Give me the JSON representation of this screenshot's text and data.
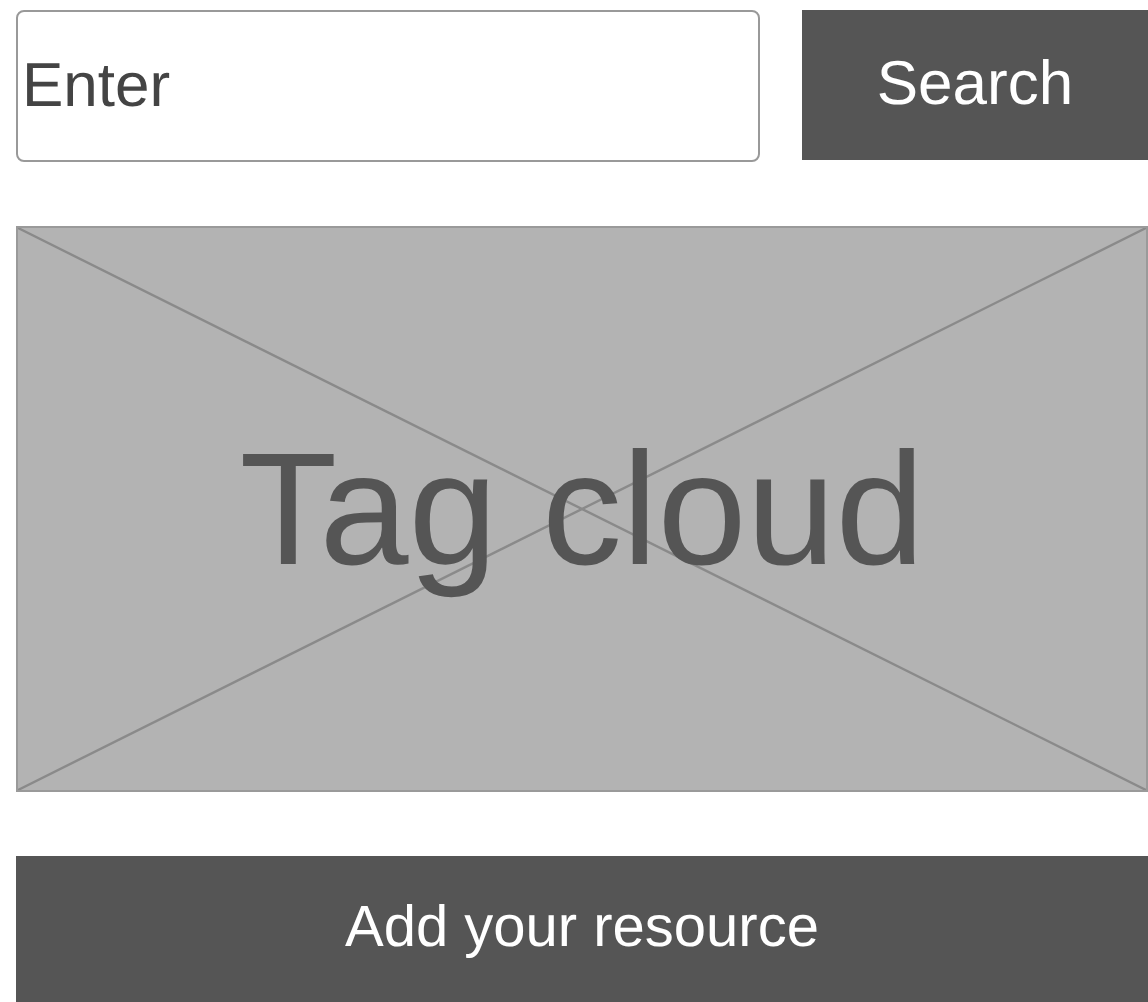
{
  "search": {
    "placeholder": "Enter",
    "button": "Search"
  },
  "tag_cloud": {
    "label": "Tag cloud"
  },
  "add_button": "Add your resource"
}
